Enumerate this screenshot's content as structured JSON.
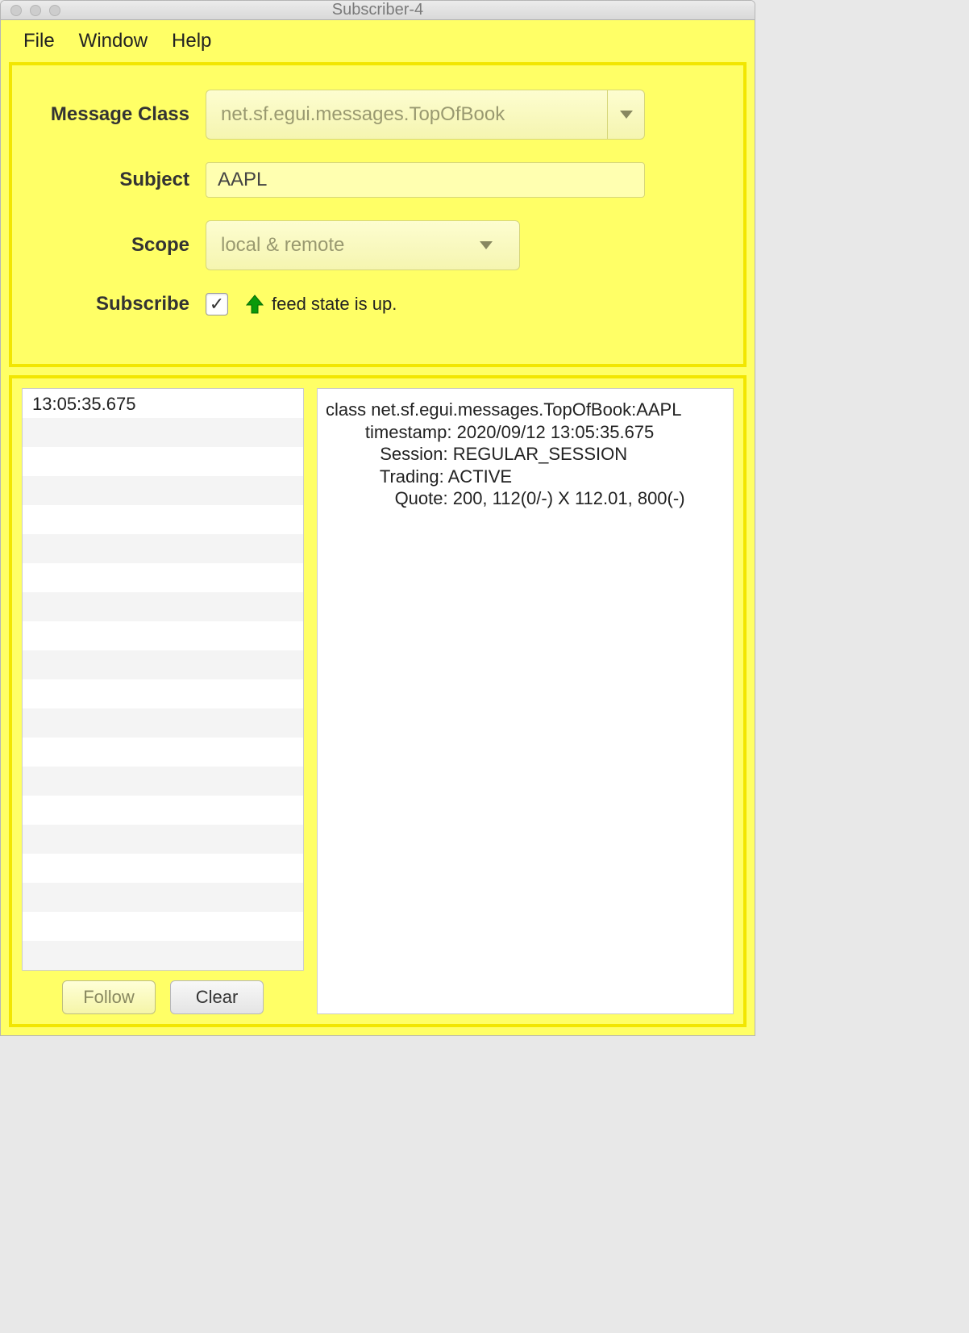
{
  "window": {
    "title": "Subscriber-4"
  },
  "menu": {
    "file": "File",
    "window": "Window",
    "help": "Help"
  },
  "form": {
    "message_class_label": "Message Class",
    "message_class_value": "net.sf.egui.messages.TopOfBook",
    "subject_label": "Subject",
    "subject_value": "AAPL",
    "scope_label": "Scope",
    "scope_value": "local & remote",
    "subscribe_label": "Subscribe",
    "subscribe_checked": true,
    "feed_state_text": "feed state is up."
  },
  "timestamps": {
    "items": [
      "13:05:35.675"
    ]
  },
  "buttons": {
    "follow": "Follow",
    "clear": "Clear"
  },
  "detail": {
    "lines": [
      "class net.sf.egui.messages.TopOfBook:AAPL",
      "        timestamp: 2020/09/12 13:05:35.675",
      "           Session: REGULAR_SESSION",
      "           Trading: ACTIVE",
      "              Quote: 200, 112(0/-) X 112.01, 800(-)"
    ]
  }
}
